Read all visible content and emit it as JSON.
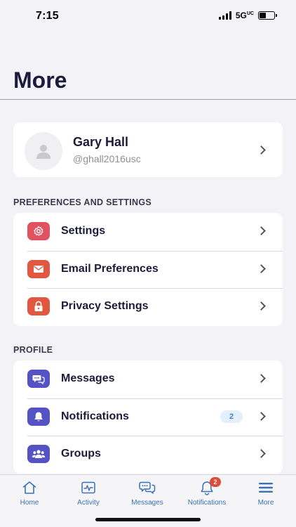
{
  "status_bar": {
    "time": "7:15",
    "network": "5G",
    "network_suffix": "UC"
  },
  "page": {
    "title": "More"
  },
  "profile": {
    "name": "Gary Hall",
    "handle": "@ghall2016usc"
  },
  "sections": {
    "preferences_header": "PREFERENCES AND SETTINGS",
    "profile_header": "PROFILE"
  },
  "preferences": [
    {
      "label": "Settings",
      "icon": "gear-icon",
      "color": "#e0525f"
    },
    {
      "label": "Email Preferences",
      "icon": "envelope-icon",
      "color": "#e2573f"
    },
    {
      "label": "Privacy Settings",
      "icon": "lock-icon",
      "color": "#e2573f"
    }
  ],
  "profile_items": [
    {
      "label": "Messages",
      "icon": "chat-icon",
      "color": "#5452c4"
    },
    {
      "label": "Notifications",
      "icon": "bell-icon",
      "color": "#5452c4",
      "badge": "2"
    },
    {
      "label": "Groups",
      "icon": "people-icon",
      "color": "#5452c4"
    }
  ],
  "tab_bar": {
    "home": "Home",
    "activity": "Activity",
    "messages": "Messages",
    "notifications": "Notifications",
    "notifications_badge": "2",
    "more": "More"
  },
  "colors": {
    "accent": "#3b6fb6",
    "title": "#1c1b3a",
    "background": "#f2f2f7"
  }
}
